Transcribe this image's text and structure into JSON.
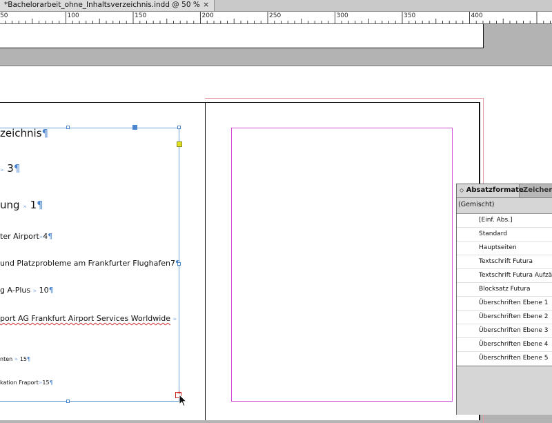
{
  "document_tab": {
    "title": "*Bachelorarbeit_ohne_Inhaltsverzeichnis.indd @ 50 %",
    "close_glyph": "×"
  },
  "ruler": {
    "marks": [
      {
        "label": "50"
      },
      {
        "label": "100"
      },
      {
        "label": "150"
      },
      {
        "label": "200"
      },
      {
        "label": "250"
      },
      {
        "label": "300"
      },
      {
        "label": "350"
      },
      {
        "label": "400"
      }
    ]
  },
  "toc": {
    "title": "zeichnis",
    "lines": [
      {
        "text": "3",
        "size": "large"
      },
      {
        "text": "ung",
        "number": "1"
      },
      {
        "text": "ter Airport",
        "number": "4"
      },
      {
        "text": "und Platzprobleme am Frankfurter Flughafen",
        "number": "7"
      },
      {
        "text": "g A-Plus",
        "number": "10"
      },
      {
        "text": "port AG Frankfurt Airport Services Worldwide",
        "number": ""
      },
      {
        "text": "nten",
        "number": "15"
      },
      {
        "text": "kation Fraport",
        "number": "15"
      }
    ],
    "pilcrow": "¶",
    "tab_arrow": "»"
  },
  "panel": {
    "tab_active": "Absatzformate",
    "tab_inactive": "Zeichenf",
    "mixed_label": "(Gemischt)",
    "styles": [
      "[Einf. Abs.]",
      "Standard",
      "Hauptseiten",
      "Textschrift Futura",
      "Textschrift Futura Aufzähl",
      "Blocksatz Futura",
      "Überschriften Ebene 1",
      "Überschriften Ebene 2",
      "Überschriften Ebene 3",
      "Überschriften Ebene 4",
      "Überschriften Ebene 5"
    ]
  },
  "colors": {
    "frame_blue": "#4a86cf",
    "margin_magenta": "#d24bd6",
    "bleed_pink": "#e39aa6",
    "overset_red": "#d02020"
  }
}
